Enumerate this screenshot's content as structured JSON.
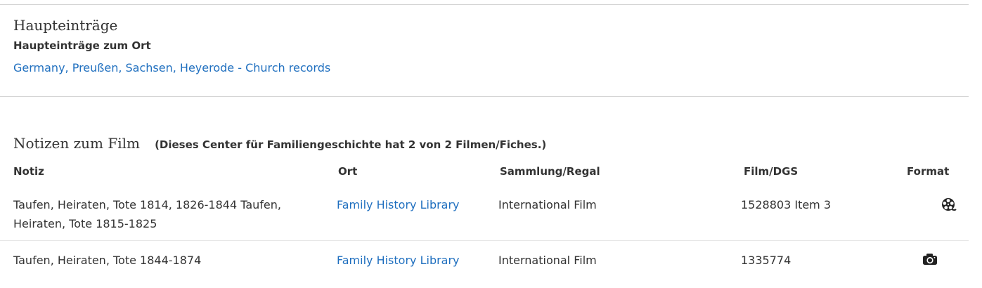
{
  "main_entries": {
    "title": "Haupteinträge",
    "subtitle": "Haupteinträge zum Ort",
    "link": "Germany, Preußen, Sachsen, Heyerode - Church records"
  },
  "film_notes": {
    "title": "Notizen zum Film",
    "count_text": "(Dieses Center für Familiengeschichte hat 2 von 2 Filmen/Fiches.)",
    "columns": [
      "Notiz",
      "Ort",
      "Sammlung/Regal",
      "Film/DGS",
      "Format"
    ],
    "rows": [
      {
        "note": "Taufen, Heiraten, Tote 1814, 1826-1844 Taufen, Heiraten, Tote 1815-1825",
        "location": "Family History Library",
        "collection": "International Film",
        "film": "1528803 Item 3",
        "format_icon": "film-reel-icon"
      },
      {
        "note": "Taufen, Heiraten, Tote 1844-1874",
        "location": "Family History Library",
        "collection": "International Film",
        "film": "1335774",
        "format_icon": "camera-icon"
      }
    ]
  },
  "colors": {
    "link": "#1f6fbf",
    "text": "#333333",
    "rule": "#d4d4d4"
  }
}
